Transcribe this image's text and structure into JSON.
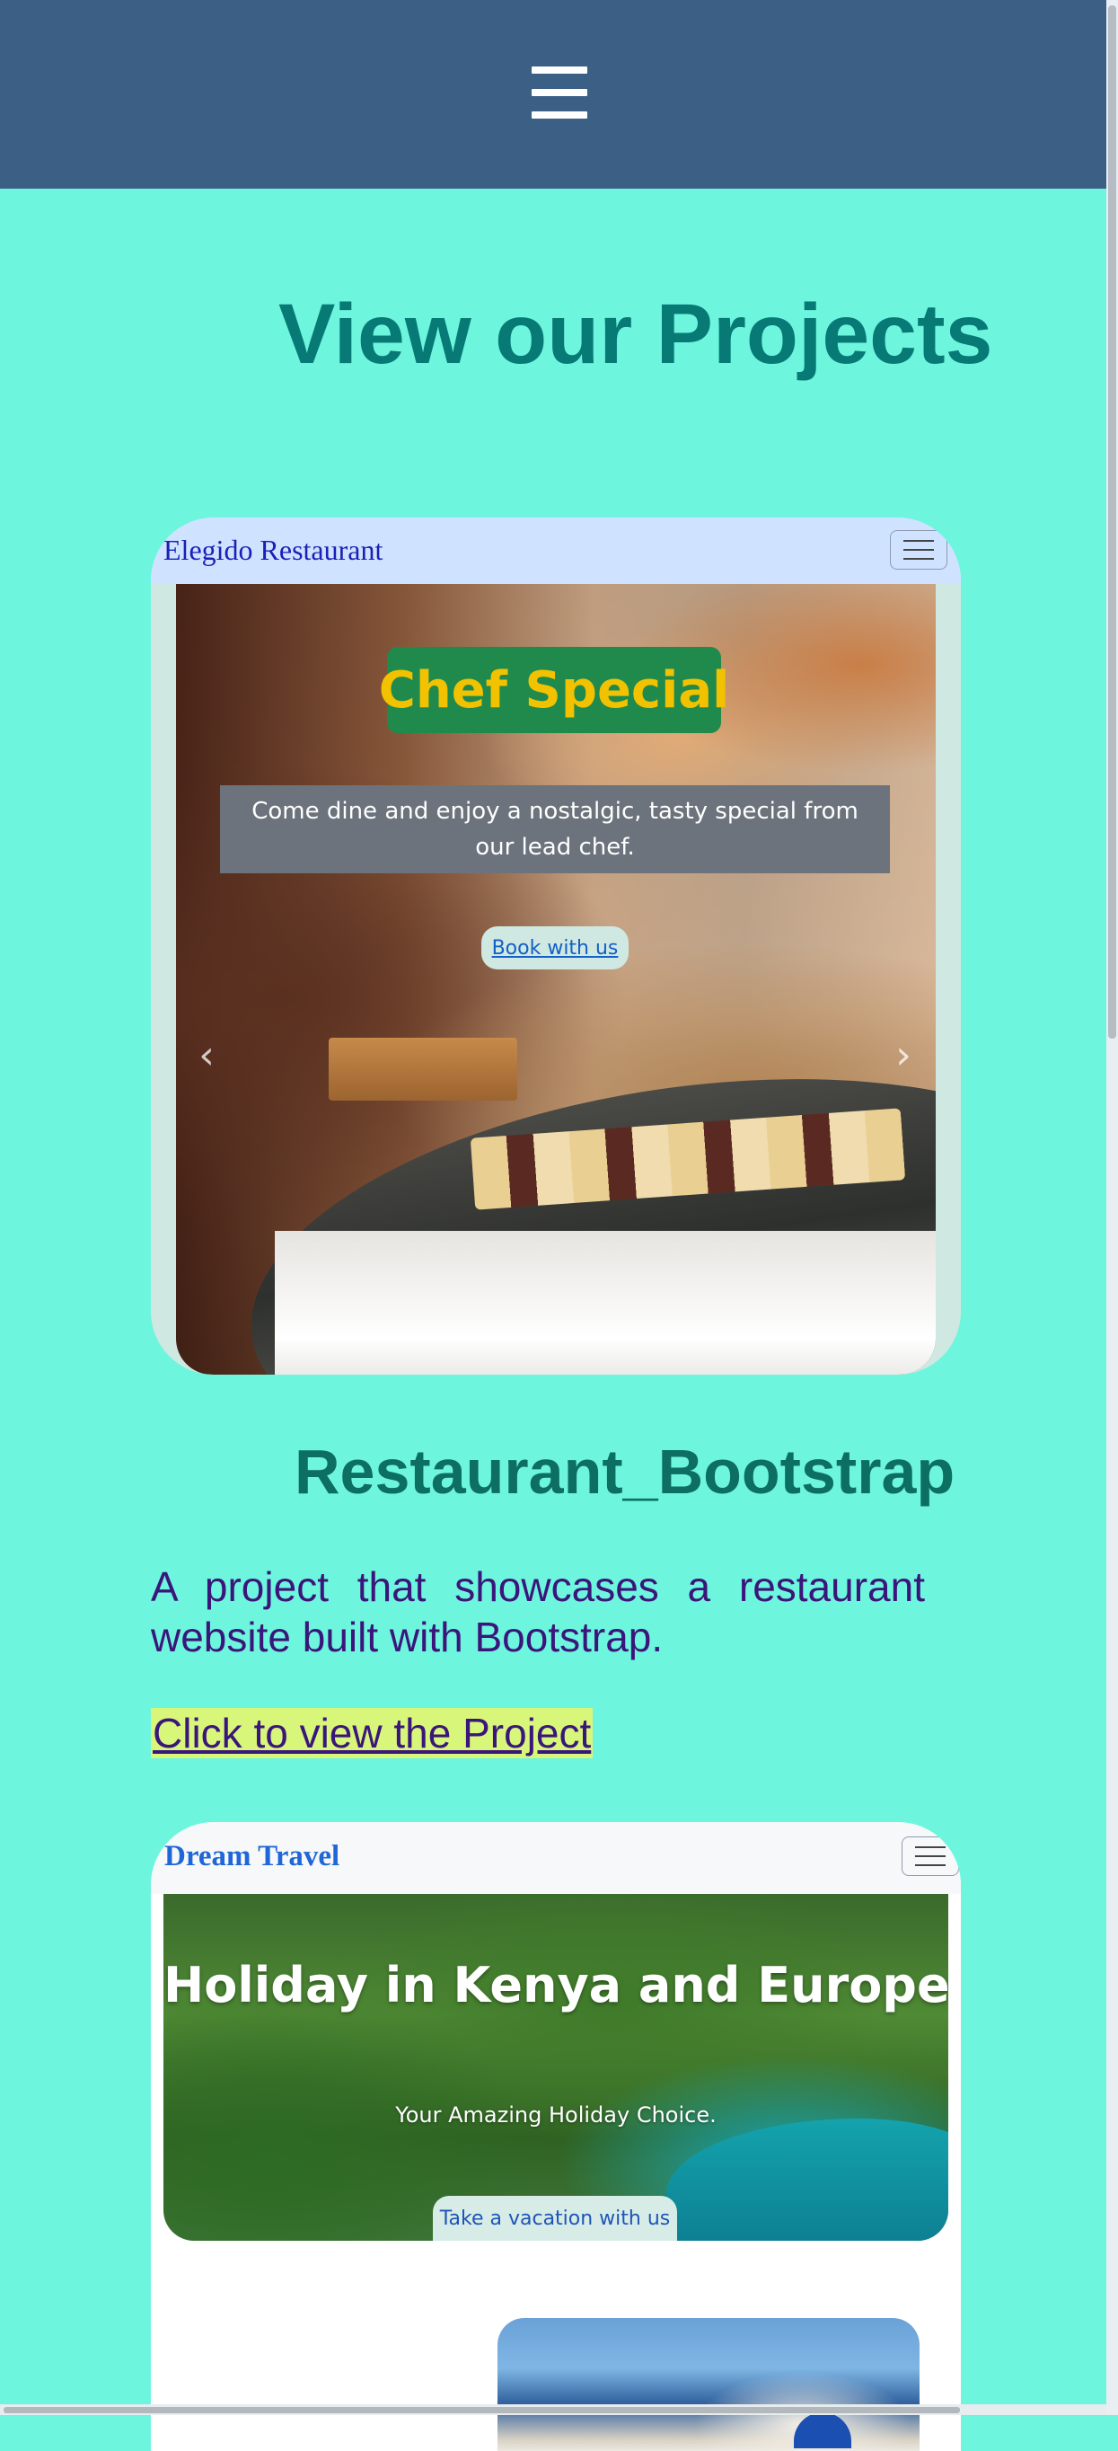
{
  "header": {
    "menu_icon": "hamburger-icon"
  },
  "page": {
    "title": "View our Projects"
  },
  "projects": [
    {
      "brand": "Elegido Restaurant",
      "hero_title": "Chef Special",
      "hero_text": "Come dine and enjoy a nostalgic, tasty special from our lead chef.",
      "hero_button": "Book with us",
      "prev_icon": "‹",
      "next_icon": "›",
      "title": "Restaurant_Bootstrap",
      "description": "A project that showcases a restaurant website built with Bootstrap.",
      "link_label": "Click to view the Project"
    },
    {
      "brand": "Dream Travel",
      "hero_title": "Holiday in Kenya and Europe",
      "hero_text": "Your Amazing Holiday Choice.",
      "hero_button": "Take a vacation with us"
    }
  ],
  "colors": {
    "page_bg": "#6ef5de",
    "header_bg": "#3c5f86",
    "title": "#087a76",
    "project_title": "#0d6e62",
    "description": "#3a167a",
    "link_highlight": "#d8f77a"
  }
}
